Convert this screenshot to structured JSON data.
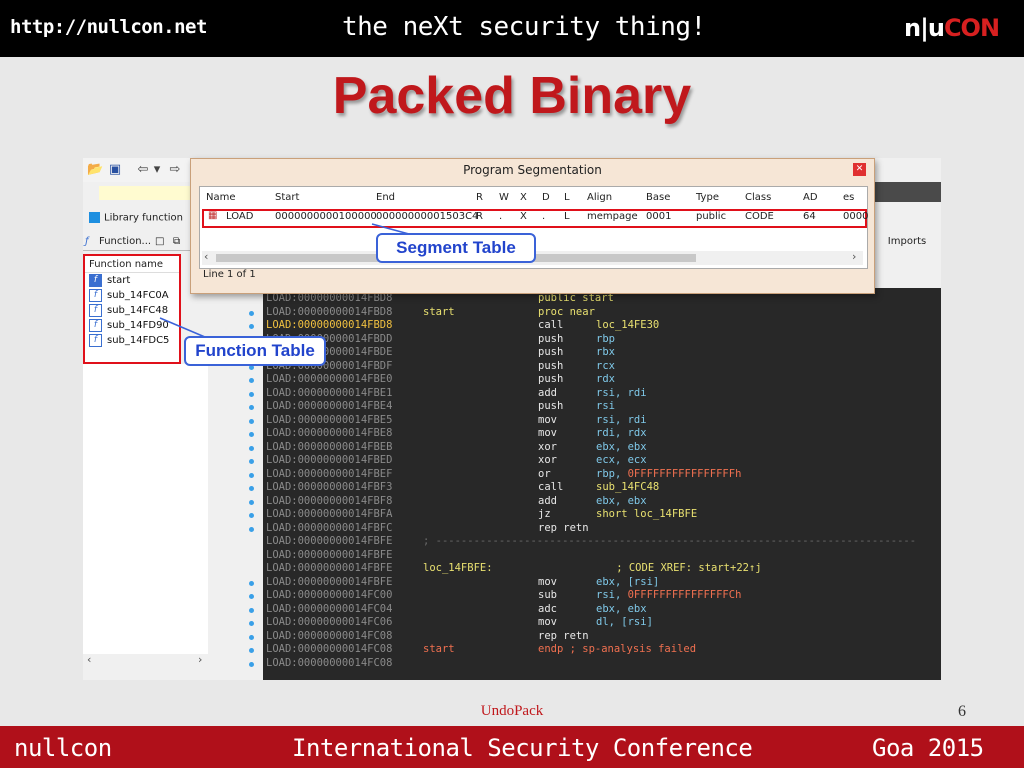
{
  "header": {
    "url": "http://nullcon.net",
    "tagline": "the neXt security thing!",
    "logo_left": "n|u",
    "logo_right": "CON"
  },
  "slide": {
    "title": "Packed Binary"
  },
  "ida": {
    "library_function_label": "Library function",
    "functions_tab_label": "Function...",
    "function_column_header": "Function name",
    "functions": [
      "start",
      "sub_14FC0A",
      "sub_14FC48",
      "sub_14FD90",
      "sub_14FDC5"
    ],
    "imports_tab": "Imports",
    "code_lines": [
      {
        "addr": "LOAD:00000000014FBD8",
        "label": "",
        "ins": "public start",
        "ops": "",
        "style": "y"
      },
      {
        "addr": "LOAD:00000000014FBD8",
        "label": "start",
        "ins": "proc near",
        "ops": "",
        "style": "y"
      },
      {
        "addr": "LOAD:00000000014FBD8",
        "label": "",
        "ins": "call",
        "ops": "loc_14FE30",
        "style": "call",
        "hl": true
      },
      {
        "addr": "LOAD:00000000014FBDD",
        "label": "",
        "ins": "push",
        "ops": "rbp"
      },
      {
        "addr": "LOAD:00000000014FBDE",
        "label": "",
        "ins": "push",
        "ops": "rbx"
      },
      {
        "addr": "LOAD:00000000014FBDF",
        "label": "",
        "ins": "push",
        "ops": "rcx"
      },
      {
        "addr": "LOAD:00000000014FBE0",
        "label": "",
        "ins": "push",
        "ops": "rdx"
      },
      {
        "addr": "LOAD:00000000014FBE1",
        "label": "",
        "ins": "add",
        "ops": "rsi, rdi"
      },
      {
        "addr": "LOAD:00000000014FBE4",
        "label": "",
        "ins": "push",
        "ops": "rsi"
      },
      {
        "addr": "LOAD:00000000014FBE5",
        "label": "",
        "ins": "mov",
        "ops": "rsi, rdi"
      },
      {
        "addr": "LOAD:00000000014FBE8",
        "label": "",
        "ins": "mov",
        "ops": "rdi, rdx"
      },
      {
        "addr": "LOAD:00000000014FBEB",
        "label": "",
        "ins": "xor",
        "ops": "ebx, ebx"
      },
      {
        "addr": "LOAD:00000000014FBED",
        "label": "",
        "ins": "xor",
        "ops": "ecx, ecx"
      },
      {
        "addr": "LOAD:00000000014FBEF",
        "label": "",
        "ins": "or",
        "ops": "rbp, 0FFFFFFFFFFFFFFFFh",
        "style": "r"
      },
      {
        "addr": "LOAD:00000000014FBF3",
        "label": "",
        "ins": "call",
        "ops": "sub_14FC48",
        "style": "call"
      },
      {
        "addr": "LOAD:00000000014FBF8",
        "label": "",
        "ins": "add",
        "ops": "ebx, ebx"
      },
      {
        "addr": "LOAD:00000000014FBFA",
        "label": "",
        "ins": "jz",
        "ops": "short loc_14FBFE",
        "style": "call"
      },
      {
        "addr": "LOAD:00000000014FBFC",
        "label": "",
        "ins": "rep retn",
        "ops": ""
      },
      {
        "addr": "LOAD:00000000014FBFE",
        "label": "; ----------------------------------------------------------------------------",
        "ins": "",
        "ops": "",
        "style": "dash"
      },
      {
        "addr": "LOAD:00000000014FBFE",
        "label": "",
        "ins": "",
        "ops": ""
      },
      {
        "addr": "LOAD:00000000014FBFE",
        "label": "loc_14FBFE:",
        "ins": "",
        "ops": "          ; CODE XREF: start+22↑j",
        "style": "xref"
      },
      {
        "addr": "LOAD:00000000014FBFE",
        "label": "",
        "ins": "mov",
        "ops": "ebx, [rsi]"
      },
      {
        "addr": "LOAD:00000000014FC00",
        "label": "",
        "ins": "sub",
        "ops": "rsi, 0FFFFFFFFFFFFFFFCh",
        "style": "r"
      },
      {
        "addr": "LOAD:00000000014FC04",
        "label": "",
        "ins": "adc",
        "ops": "ebx, ebx"
      },
      {
        "addr": "LOAD:00000000014FC06",
        "label": "",
        "ins": "mov",
        "ops": "dl, [rsi]"
      },
      {
        "addr": "LOAD:00000000014FC08",
        "label": "",
        "ins": "rep retn",
        "ops": ""
      },
      {
        "addr": "LOAD:00000000014FC08",
        "label": "start",
        "ins": "endp ; sp-analysis failed",
        "ops": "",
        "style": "rlab"
      },
      {
        "addr": "LOAD:00000000014FC08",
        "label": "",
        "ins": "",
        "ops": ""
      }
    ]
  },
  "segment_dialog": {
    "title": "Program Segmentation",
    "columns": [
      "Name",
      "Start",
      "End",
      "R",
      "W",
      "X",
      "D",
      "L",
      "Align",
      "Base",
      "Type",
      "Class",
      "AD",
      "es"
    ],
    "row": [
      "LOAD",
      "0000000000100000",
      "00000000001503C4",
      "R",
      ".",
      "X",
      ".",
      "L",
      "mempage",
      "0001",
      "public",
      "CODE",
      "64",
      "0000"
    ],
    "status": "Line 1 of 1"
  },
  "callouts": {
    "segment": "Segment Table",
    "function": "Function Table"
  },
  "footer": {
    "center": "UndoPack",
    "page": "6",
    "left": "nullcon",
    "middle": "International Security Conference",
    "right": "Goa 2015"
  },
  "colors": {
    "accent_red": "#c0181c",
    "callout_blue": "#3a62d8",
    "highlight_box": "#e0101a"
  }
}
